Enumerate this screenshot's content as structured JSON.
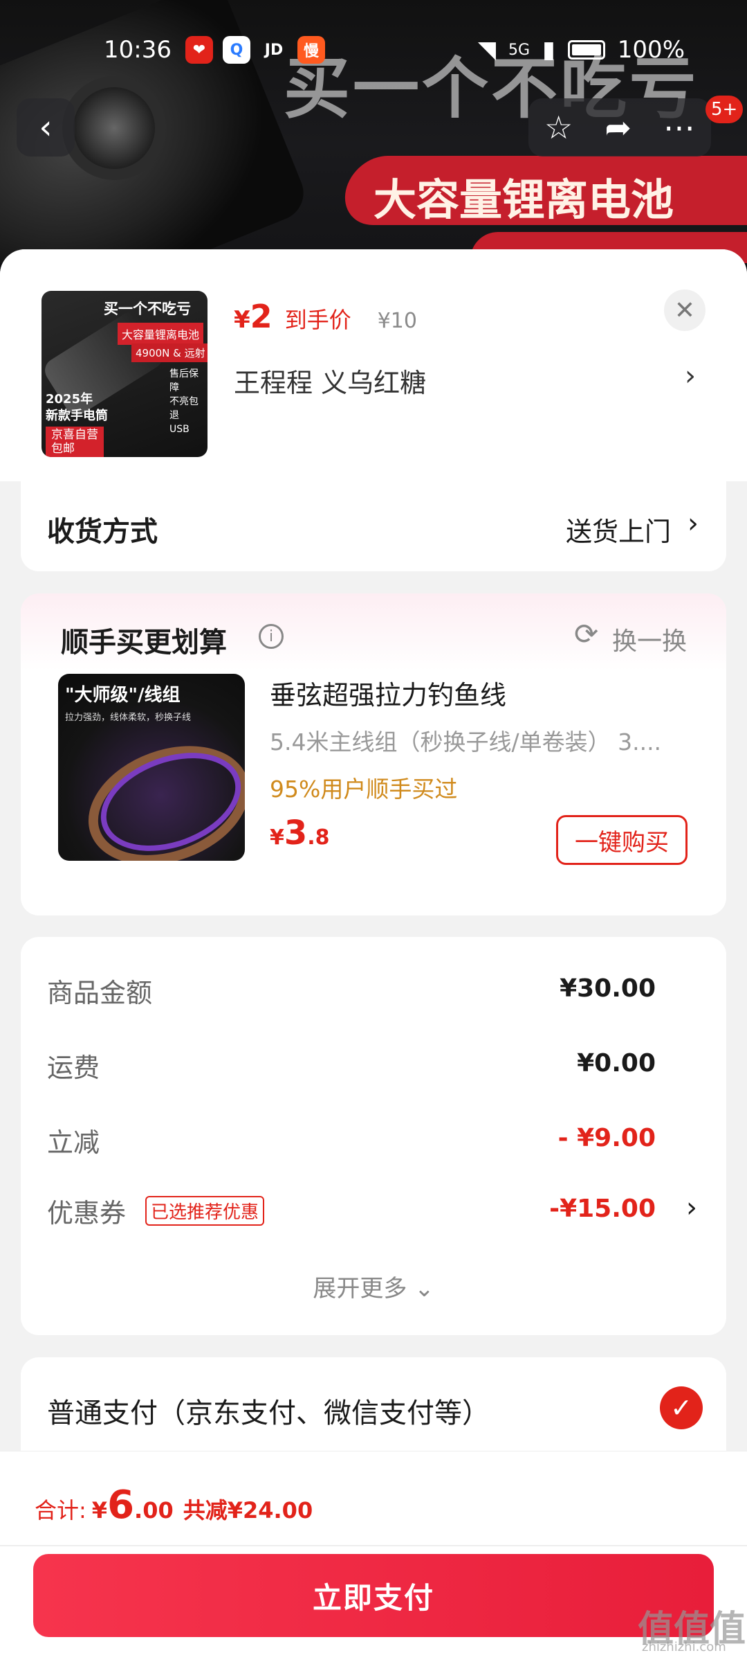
{
  "status_bar": {
    "time": "10:36",
    "app_icons": [
      "❤",
      "Q",
      "JD",
      "慢"
    ],
    "network": "5G",
    "battery": "100%"
  },
  "hero": {
    "promo_big": "买一个不吃亏",
    "promo_red": "大容量锂离电池",
    "cart_badge": "5+"
  },
  "product": {
    "thumb": {
      "title": "买一个不吃亏",
      "red_banner": "大容量锂离电池",
      "spec": "4900N & 远射",
      "side_lines": [
        "售后保障",
        "不亮包退",
        "",
        "USB"
      ],
      "year_line1": "2025年",
      "year_line2": "新款手电筒",
      "tag_line1": "京喜自营",
      "tag_line2": "包邮"
    },
    "price_symbol": "¥",
    "price": "2",
    "price_label": "到手价",
    "original_price": "¥10",
    "sku": "王程程  义乌红糖"
  },
  "delivery": {
    "label": "收货方式",
    "value": "送货上门"
  },
  "upsell": {
    "title": "顺手买更划算",
    "refresh_label": "换一换",
    "thumb_title": "\"大师级\"/线组",
    "thumb_sub": "拉力强劲，线体柔软，秒换子线",
    "name": "垂弦超强拉力钓鱼线",
    "spec": "5.4米主线组（秒换子线/单卷装）  3....",
    "social": "95%用户顺手买过",
    "price_symbol": "¥",
    "price_int": "3",
    "price_dec": ".8",
    "buy_label": "一键购买"
  },
  "summary": {
    "rows": [
      {
        "label": "商品金额",
        "value": "¥30.00"
      },
      {
        "label": "运费",
        "value": "¥0.00"
      },
      {
        "label": "立减",
        "value": "- ¥9.00"
      },
      {
        "label": "优惠券",
        "value": "-¥15.00",
        "tag": "已选推荐优惠"
      }
    ],
    "expand_label": "展开更多 ⌄"
  },
  "payment": {
    "method": "普通支付（京东支付、微信支付等）"
  },
  "bottom": {
    "total_label": "合计:",
    "total_symbol": "¥",
    "total_int": "6",
    "total_dec": ".00",
    "saved": "共减¥24.00",
    "pay_label": "立即支付"
  },
  "watermark": {
    "text": "值值值",
    "sub": "zhizhizhi.com"
  },
  "colors": {
    "accent": "#e2231a",
    "pay_button": "#f6344d",
    "social_proof": "#d08a1c"
  },
  "icons": {
    "back": "back-arrow-icon",
    "favorite": "star-icon",
    "share": "share-icon",
    "more": "more-icon",
    "close": "close-icon",
    "info": "info-icon",
    "refresh": "refresh-icon",
    "check": "check-icon",
    "chevron": "chevron-right-icon"
  }
}
